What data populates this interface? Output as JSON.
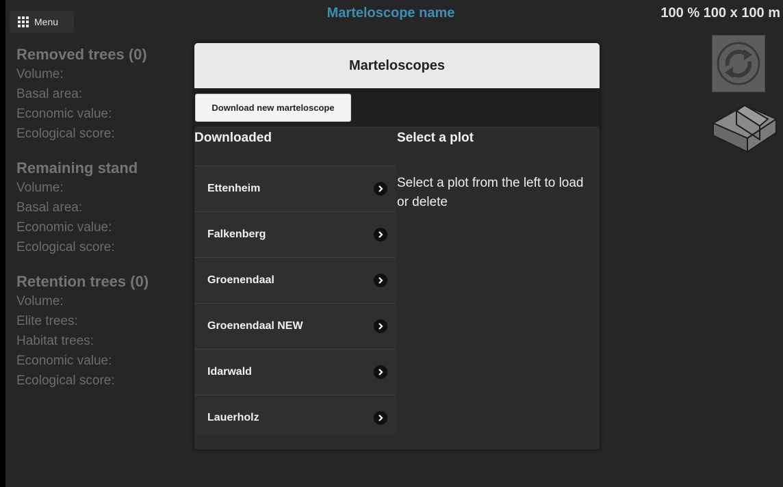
{
  "topbar": {
    "menu_label": "Menu",
    "title": "Marteloscope name",
    "scale_text": "100 % 100 x 100 m"
  },
  "stats": {
    "removed": {
      "title": "Removed trees (0)",
      "rows": [
        "Volume:",
        "Basal area:",
        "Economic value:",
        "Ecological score:"
      ]
    },
    "remaining": {
      "title": "Remaining stand",
      "rows": [
        "Volume:",
        "Basal area:",
        "Economic value:",
        "Ecological score:"
      ]
    },
    "retention": {
      "title": "Retention trees (0)",
      "rows": [
        "Volume:",
        "Elite trees:",
        "Habitat trees:",
        "Economic value:",
        "Ecological score:"
      ]
    }
  },
  "modal": {
    "title": "Marteloscopes",
    "download_label": "Download new marteloscope",
    "downloaded_heading": "Downloaded",
    "select_heading": "Select a plot",
    "select_hint": "Select a plot from the left to load or delete",
    "plots": [
      "Ettenheim",
      "Falkenberg",
      "Groenendaal",
      "Groenendaal NEW",
      "Idarwald",
      "Lauerholz"
    ]
  },
  "icons": {
    "menu": "grid-icon",
    "sync": "sync-icon",
    "eraser": "eraser-icon",
    "chevron": "chevron-right-icon"
  },
  "colors": {
    "background": "#262626",
    "title": "#3d8fb5",
    "header": "#e9e9e9"
  }
}
